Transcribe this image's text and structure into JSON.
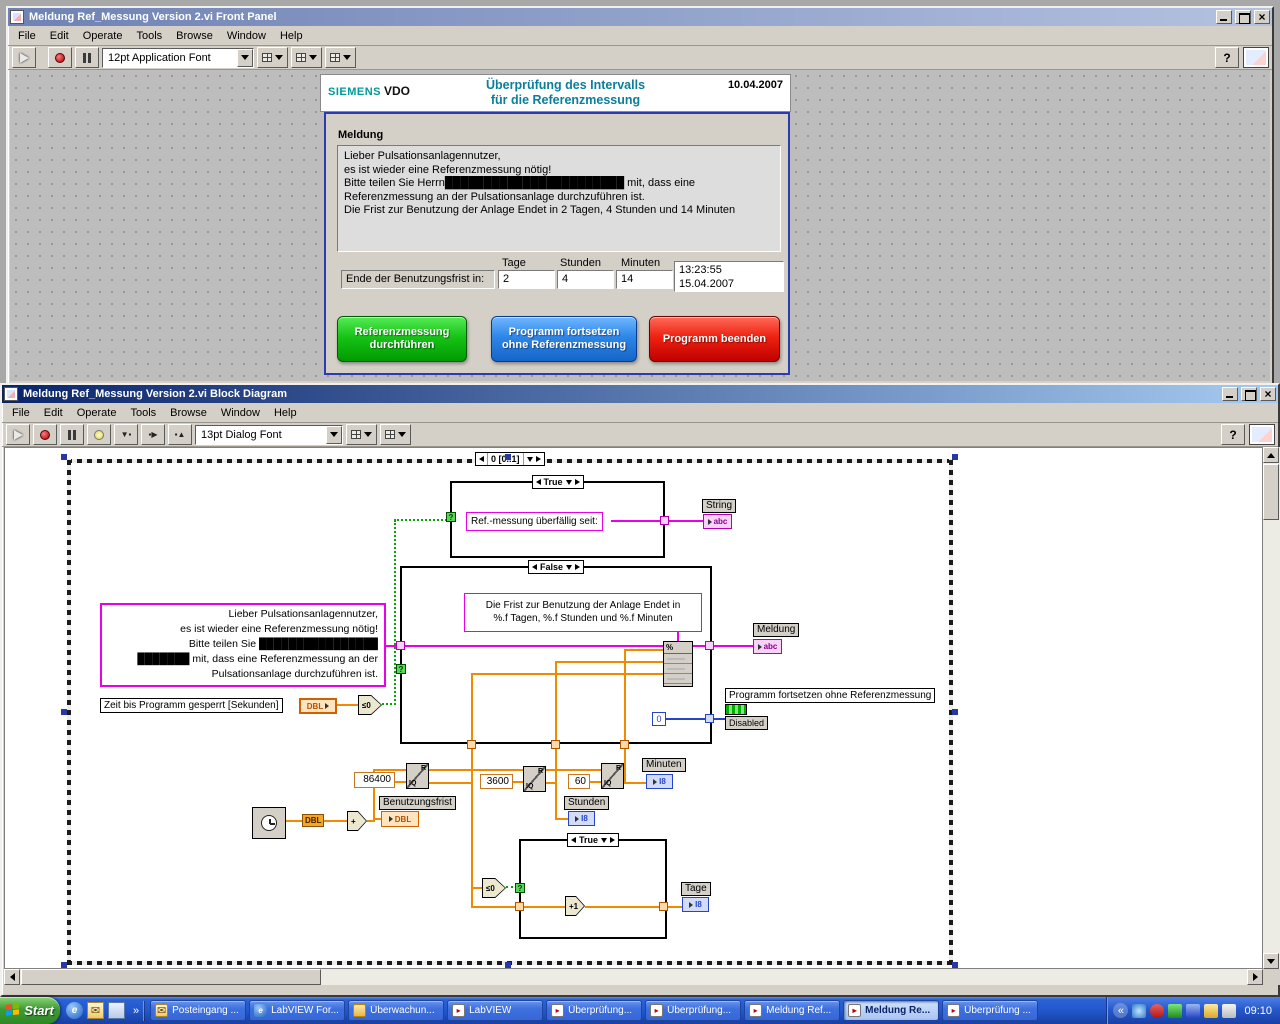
{
  "menu": [
    "File",
    "Edit",
    "Operate",
    "Tools",
    "Browse",
    "Window",
    "Help"
  ],
  "front_panel": {
    "window_title": "Meldung Ref_Messung Version 2.vi Front Panel",
    "toolbar": {
      "font_selector": "12pt Application Font"
    },
    "header": {
      "brand_left": "SIEMENS",
      "brand_right": "VDO",
      "title_line1": "Überprüfung des Intervalls",
      "title_line2": "für die Referenzmessung",
      "date": "10.04.2007"
    },
    "message_panel": {
      "label": "Meldung",
      "lines": [
        "Lieber Pulsationsanlagennutzer,",
        "es ist wieder eine Referenzmessung nötig!",
        "Bitte teilen Sie Herrn███████████████████████ mit, dass eine",
        "Referenzmessung an der Pulsationsanlage durchzuführen ist.",
        "Die Frist zur Benutzung der Anlage Endet in 2 Tagen, 4 Stunden und 14 Minuten"
      ]
    },
    "deadline": {
      "col_tage": "Tage",
      "col_stunden": "Stunden",
      "col_minuten": "Minuten",
      "row_label": "Ende der Benutzungsfrist in:",
      "tage": "2",
      "stunden": "4",
      "minuten": "14",
      "time": "13:23:55",
      "date": "15.04.2007"
    },
    "buttons": {
      "ref_line1": "Referenzmessung",
      "ref_line2": "durchführen",
      "continue_line1": "Programm fortsetzen",
      "continue_line2": "ohne Referenzmessung",
      "quit": "Programm beenden"
    }
  },
  "block_diagram": {
    "window_title": "Meldung Ref_Messung Version 2.vi Block Diagram",
    "toolbar": {
      "font_selector": "13pt Dialog Font"
    },
    "diagram": {
      "sequence_selector": "0 [0..1]",
      "case_true_top": "True",
      "case_false": "False",
      "case_true_bottom": "True",
      "string_const_overdue": "Ref.-messung überfällig seit:",
      "string_label": "String",
      "string_terminal": "abc",
      "frist_line1": "Die Frist zur Benutzung der Anlage Endet in",
      "frist_line2": "%.f Tagen, %.f Stunden und %.f Minuten",
      "meldung_label": "Meldung",
      "meldung_terminal": "abc",
      "message_lines": [
        "Lieber Pulsationsanlagennutzer,",
        "es ist wieder eine Referenzmessung nötig!",
        "Bitte teilen Sie ████████████████",
        "███████ mit, dass eine Referenzmessung an der",
        "Pulsationsanlage durchzuführen ist."
      ],
      "zeit_label": "Zeit  bis Programm gesperrt [Sekunden]",
      "dbl": "DBL",
      "i8": "I8",
      "benutzungsfrist_label": "Benutzungsfrist",
      "const_86400": "86400",
      "const_3600": "3600",
      "const_60": "60",
      "const_0": "0",
      "minuten_label": "Minuten",
      "stunden_label": "Stunden",
      "tage_label": "Tage",
      "property_label": "Programm fortsetzen ohne Referenzmessung",
      "property_value": "Disabled",
      "lte_zero": "≤0",
      "add_label": "+",
      "increment_label": "+1",
      "qr_r": "R",
      "qr_iq": "IQ",
      "fmt_glyph": "%",
      "selector_q": "?"
    }
  },
  "taskbar": {
    "start": "Start",
    "quick_launch": {
      "chevron": "»",
      "icons": [
        {
          "name": "internet-explorer-icon",
          "cls": "ico-ie"
        },
        {
          "name": "outlook-icon",
          "cls": "ico-mail"
        },
        {
          "name": "show-desktop-icon",
          "cls": "ico-desk"
        }
      ]
    },
    "tasks": [
      {
        "label": "Posteingang ...",
        "icon": "ico-mail",
        "state": ""
      },
      {
        "label": "LabVIEW For...",
        "icon": "ico-ie",
        "state": ""
      },
      {
        "label": "Überwachun...",
        "icon": "ico-folder",
        "state": ""
      },
      {
        "label": "LabVIEW",
        "icon": "ico-lv",
        "state": ""
      },
      {
        "label": "Überprüfung...",
        "icon": "ico-lv",
        "state": ""
      },
      {
        "label": "Überprüfung...",
        "icon": "ico-lv",
        "state": ""
      },
      {
        "label": "Meldung Ref...",
        "icon": "ico-lv",
        "state": ""
      },
      {
        "label": "Meldung Re...",
        "icon": "ico-lv",
        "state": "active"
      },
      {
        "label": "Überprüfung ...",
        "icon": "ico-lv",
        "state": ""
      }
    ],
    "tray": {
      "chevron": "«",
      "icons": [
        {
          "name": "update-icon",
          "cls": "ti-a"
        },
        {
          "name": "antivirus-icon",
          "cls": "ti-b"
        },
        {
          "name": "messenger-icon",
          "cls": "ti-c"
        },
        {
          "name": "network-icon",
          "cls": "ti-d"
        },
        {
          "name": "volume-icon",
          "cls": "ti-e"
        },
        {
          "name": "display-icon",
          "cls": "ti-f"
        }
      ],
      "clock": "09:10"
    }
  }
}
